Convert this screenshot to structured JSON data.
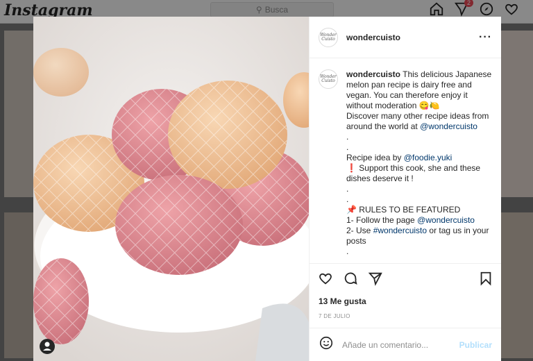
{
  "app": {
    "logo": "Instagram"
  },
  "search": {
    "placeholder": "Busca"
  },
  "nav": {
    "notifications_count": "2"
  },
  "post": {
    "username": "wondercuisto",
    "avatar_text": "Wonder Cuisto",
    "caption_lines": [
      "This delicious Japanese melon pan recipe is dairy free and vegan. You can therefore enjoy it without moderation 😋🍋",
      "Discover many other recipe ideas from around the world at",
      "@wondercuisto",
      "Recipe idea by",
      "@foodie.yuki",
      "❗ Support this cook, she and these dishes deserve it !",
      "📌 RULES TO BE FEATURED",
      "1- Follow the page",
      "@wondercuisto",
      "2- Use",
      "#wondercuisto",
      "or tag us in your posts"
    ],
    "dots": ".",
    "likes": "13 Me gusta",
    "date": "7 DE JULIO",
    "comment_placeholder": "Añade un comentario...",
    "publish_label": "Publicar"
  }
}
